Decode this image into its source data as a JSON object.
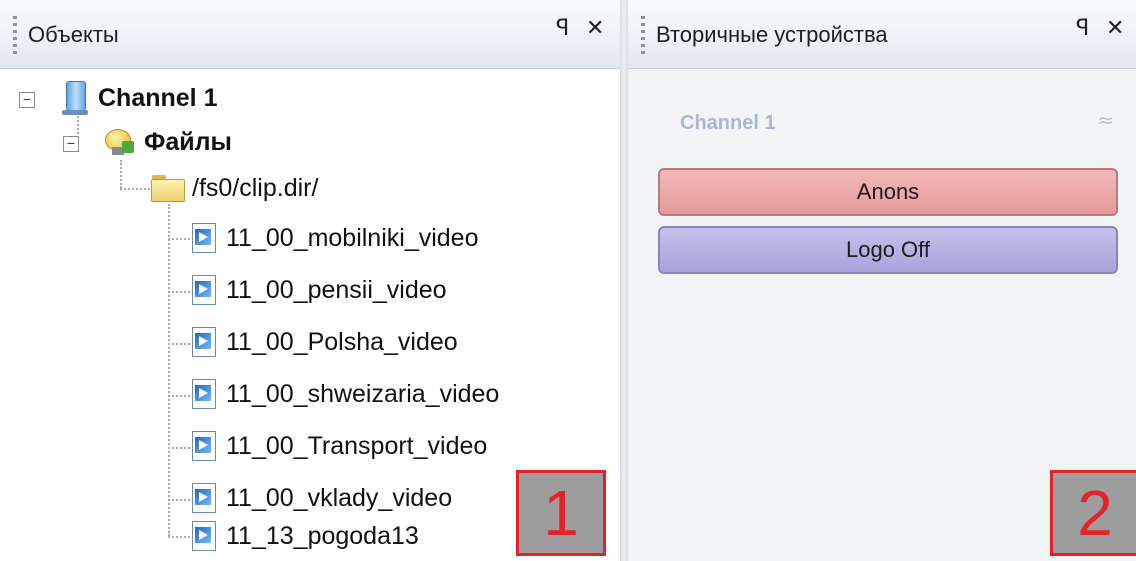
{
  "left_panel": {
    "title": "Объекты",
    "pin_glyph": "ꟼ",
    "close_glyph": "✕",
    "tree": {
      "channel": "Channel 1",
      "files": "Файлы",
      "folder": "/fs0/clip.dir/",
      "items": [
        "11_00_mobilniki_video",
        "11_00_pensii_video",
        "11_00_Polsha_video",
        "11_00_shweizaria_video",
        "11_00_Transport_video",
        "11_00_vklady_video",
        "11_13_pogoda13"
      ]
    },
    "marker": "1"
  },
  "right_panel": {
    "title": "Вторичные устройства",
    "pin_glyph": "ꟼ",
    "close_glyph": "✕",
    "group_label": "Channel 1",
    "collapse_glyph": "≈",
    "buttons": [
      {
        "label": "Anons",
        "color": "#e8a4a4"
      },
      {
        "label": "Logo Off",
        "color": "#b3addf"
      }
    ],
    "marker": "2"
  },
  "icons": {
    "channel": "computer-icon",
    "files": "files-icon",
    "folder": "folder-icon",
    "item": "video-file-icon"
  },
  "colors": {
    "marker_border": "#e2232a",
    "marker_fill": "#9d9d9d"
  }
}
